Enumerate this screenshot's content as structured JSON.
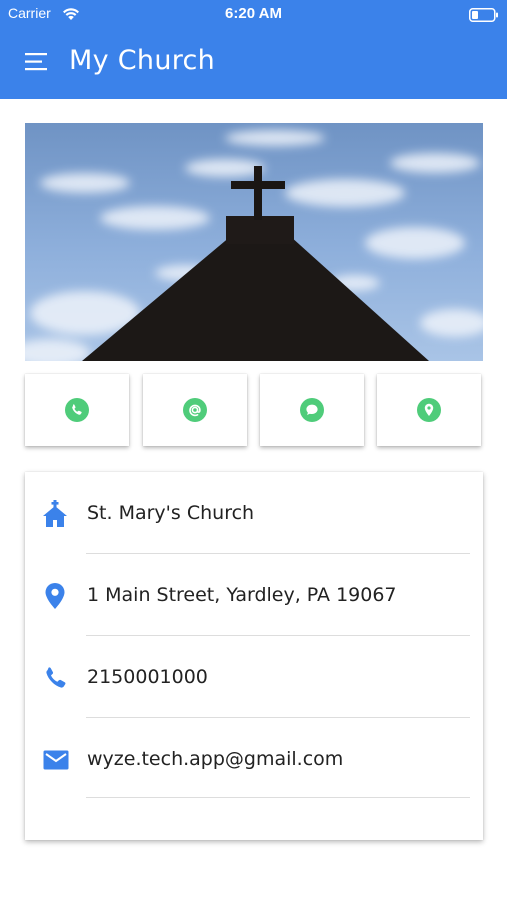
{
  "status_bar": {
    "carrier": "Carrier",
    "time": "6:20 AM"
  },
  "app_bar": {
    "title": "My Church"
  },
  "hero": {
    "description_icon": "church-steeple-cross-photo"
  },
  "actions": [
    {
      "id": "call",
      "icon": "phone-icon"
    },
    {
      "id": "email",
      "icon": "at-icon"
    },
    {
      "id": "message",
      "icon": "chat-icon"
    },
    {
      "id": "location",
      "icon": "location-pin-icon"
    }
  ],
  "info": {
    "name": "St. Mary's Church",
    "address": "1 Main Street, Yardley, PA 19067",
    "phone": "2150001000",
    "email": "wyze.tech.app@gmail.com"
  },
  "colors": {
    "primary": "#3b82ea",
    "action_green": "#4fcc7a",
    "info_icon_blue": "#3b82ea"
  }
}
